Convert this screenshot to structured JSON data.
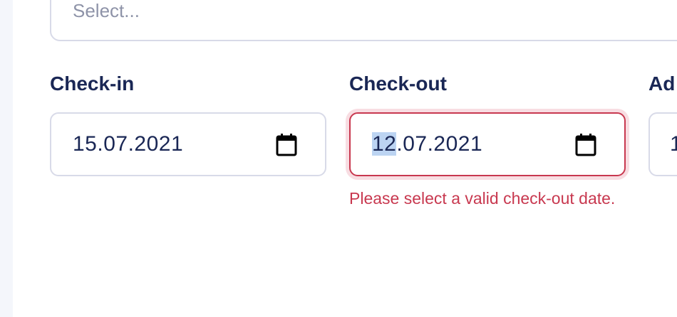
{
  "room_select": {
    "placeholder": "Select..."
  },
  "checkin": {
    "label": "Check-in",
    "value": "15.07.2021"
  },
  "checkout": {
    "label": "Check-out",
    "value_day": "12",
    "value_rest": ".07.2021",
    "error": "Please select a valid check-out date."
  },
  "adults": {
    "label": "Ad",
    "value": "1"
  },
  "icons": {
    "date_picker": "calendar-icon"
  },
  "colors": {
    "label": "#1a2755",
    "border": "#d8dae8",
    "error": "#c8384f",
    "error_halo": "#f8dde2",
    "placeholder": "#8e93a8",
    "selection": "#bcd4f2"
  }
}
